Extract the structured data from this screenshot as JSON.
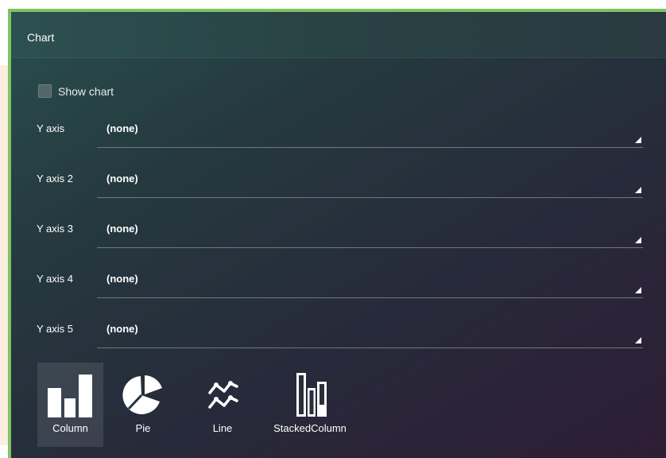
{
  "panel": {
    "title": "Chart"
  },
  "show_chart": {
    "label": "Show chart",
    "checked": false
  },
  "axes": [
    {
      "label": "Y axis",
      "value": "(none)"
    },
    {
      "label": "Y axis 2",
      "value": "(none)"
    },
    {
      "label": "Y axis 3",
      "value": "(none)"
    },
    {
      "label": "Y axis 4",
      "value": "(none)"
    },
    {
      "label": "Y axis 5",
      "value": "(none)"
    }
  ],
  "chart_types": [
    {
      "label": "Column",
      "icon": "column-chart-icon",
      "selected": true
    },
    {
      "label": "Pie",
      "icon": "pie-chart-icon",
      "selected": false
    },
    {
      "label": "Line",
      "icon": "line-chart-icon",
      "selected": false
    },
    {
      "label": "StackedColumn",
      "icon": "stacked-column-chart-icon",
      "selected": false
    }
  ],
  "colors": {
    "accent_border": "#7ec463",
    "panel_bg_start": "#2a4e4d",
    "panel_bg_end": "#2e1d35",
    "text": "#ffffff"
  }
}
